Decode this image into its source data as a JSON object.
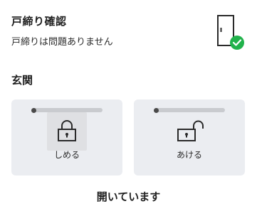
{
  "lock_check": {
    "title": "戸締り確認",
    "status_text": "戸締りは問題ありません",
    "door_icon": "door-with-check-icon",
    "ok_color": "#21b24b"
  },
  "section": {
    "title": "玄関"
  },
  "controls": {
    "lock_label": "しめる",
    "unlock_label": "あける",
    "lock_icon": "padlock-closed-icon",
    "unlock_icon": "padlock-open-icon"
  },
  "footer": {
    "status": "開いています"
  }
}
